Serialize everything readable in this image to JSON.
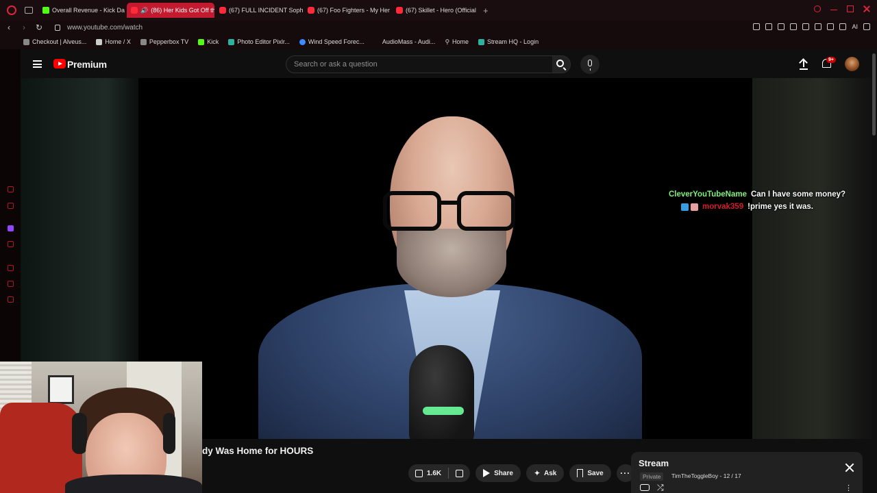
{
  "browser": {
    "tabs": [
      {
        "label": "Overall Revenue - Kick Da",
        "icon": "kick-icon",
        "active": false
      },
      {
        "label": "(86) Her Kids Got Off th",
        "icon": "speaker-icon",
        "active": true
      },
      {
        "label": "(67) FULL INCIDENT Soph",
        "icon": "youtube-icon",
        "active": false
      },
      {
        "label": "(67) Foo Fighters - My Her",
        "icon": "youtube-icon",
        "active": false
      },
      {
        "label": "(67) Skillet - Hero (Official",
        "icon": "youtube-icon",
        "active": false
      }
    ],
    "new_tab": "+",
    "url": "www.youtube.com/watch",
    "toolbar_ai": "AI",
    "bookmarks": [
      {
        "label": "Checkout | Alveus...",
        "icon": "generic"
      },
      {
        "label": "Home / X",
        "icon": "x"
      },
      {
        "label": "Pepperbox TV",
        "icon": "generic"
      },
      {
        "label": "Kick",
        "icon": "kick"
      },
      {
        "label": "Photo Editor Pixlr...",
        "icon": "green"
      },
      {
        "label": "Wind Speed Forec...",
        "icon": "blue"
      },
      {
        "label": "AudioMass - Audi...",
        "icon": "generic"
      },
      {
        "label": "Home",
        "icon": "pin"
      },
      {
        "label": "Stream HQ - Login",
        "icon": "green"
      }
    ],
    "accent_color": "#e0263a"
  },
  "youtube": {
    "brand": "Premium",
    "search_placeholder": "Search or ask a question",
    "notification_badge": "9+"
  },
  "chat": [
    {
      "user": "CleverYouTubeName",
      "message": "Can I have some money?",
      "user_color": "#7ef07a"
    },
    {
      "user": "morvak359",
      "message": "!prime yes it was.",
      "user_color": "#d71a2a"
    }
  ],
  "video": {
    "title": "dy Was Home for HOURS",
    "like_count": "1.6K",
    "actions": {
      "share": "Share",
      "ask": "Ask",
      "save": "Save"
    }
  },
  "playlist": {
    "title": "Stream",
    "privacy": "Private",
    "owner_position": "TimTheToggleBoy - 12 / 17"
  }
}
